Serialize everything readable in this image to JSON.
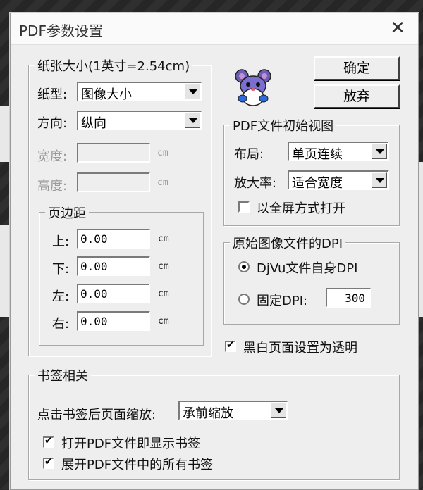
{
  "window": {
    "title": "PDF参数设置",
    "close_glyph": "✕"
  },
  "paper": {
    "legend": "纸张大小(1英寸=2.54cm)",
    "type_label": "纸型:",
    "type_value": "图像大小",
    "orientation_label": "方向:",
    "orientation_value": "纵向",
    "width_label": "宽度:",
    "height_label": "高度:",
    "unit": "cm",
    "margins": {
      "legend": "页边距",
      "items": [
        {
          "label": "上:",
          "value": "0.00"
        },
        {
          "label": "下:",
          "value": "0.00"
        },
        {
          "label": "左:",
          "value": "0.00"
        },
        {
          "label": "右:",
          "value": "0.00"
        }
      ]
    }
  },
  "buttons": {
    "ok": "确定",
    "cancel": "放弃"
  },
  "initial_view": {
    "legend": "PDF文件初始视图",
    "layout_label": "布局:",
    "layout_value": "单页连续",
    "zoom_label": "放大率:",
    "zoom_value": "适合宽度",
    "fullscreen_label": "以全屏方式打开",
    "fullscreen_checked": false
  },
  "dpi": {
    "legend": "原始图像文件的DPI",
    "option1": "DjVu文件自身DPI",
    "option2": "固定DPI:",
    "fixed_value": "300",
    "selected": "option1"
  },
  "transparent": {
    "label": "黑白页面设置为透明",
    "checked": true
  },
  "bookmarks": {
    "legend": "书签相关",
    "zoom_label": "点击书签后页面缩放:",
    "zoom_value": "承前缩放",
    "show_label": "打开PDF文件即显示书签",
    "show_checked": true,
    "expand_label": "展开PDF文件中的所有书签",
    "expand_checked": true
  }
}
